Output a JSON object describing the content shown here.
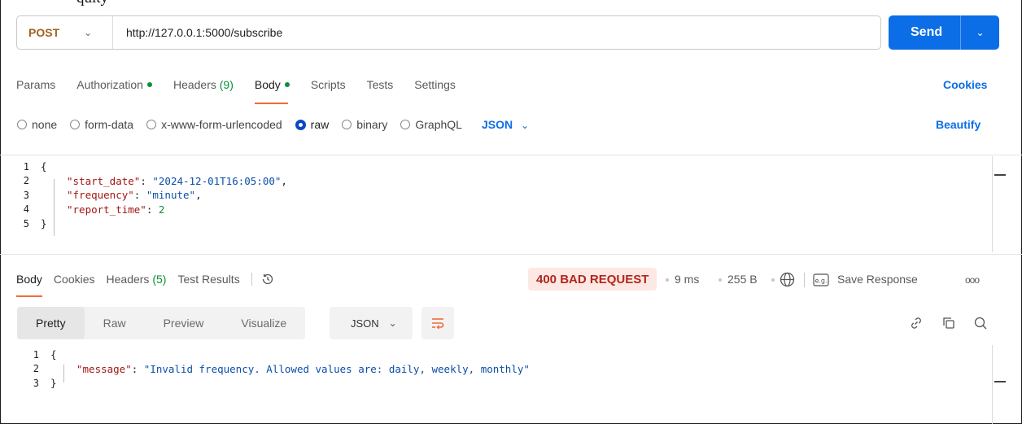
{
  "caption_fragment": "quity",
  "request": {
    "method": "POST",
    "url": "http://127.0.0.1:5000/subscribe",
    "send_label": "Send",
    "tabs": [
      {
        "label": "Params"
      },
      {
        "label": "Authorization"
      },
      {
        "label": "Headers",
        "count": "(9)"
      },
      {
        "label": "Body"
      },
      {
        "label": "Scripts"
      },
      {
        "label": "Tests"
      },
      {
        "label": "Settings"
      }
    ],
    "cookies_label": "Cookies",
    "body_types": [
      "none",
      "form-data",
      "x-www-form-urlencoded",
      "raw",
      "binary",
      "GraphQL"
    ],
    "selected_body_type": "raw",
    "language": "JSON",
    "beautify_label": "Beautify",
    "body_lines": [
      {
        "n": "1",
        "open": "{"
      },
      {
        "n": "2",
        "key": "\"start_date\"",
        "sep": ": ",
        "value": "\"2024-12-01T16:05:00\"",
        "tail": ","
      },
      {
        "n": "3",
        "key": "\"frequency\"",
        "sep": ": ",
        "value": "\"minute\"",
        "tail": ","
      },
      {
        "n": "4",
        "key": "\"report_time\"",
        "sep": ": ",
        "number": "2",
        "tail": ""
      },
      {
        "n": "5",
        "close": "}"
      }
    ]
  },
  "response": {
    "tabs": [
      {
        "label": "Body"
      },
      {
        "label": "Cookies"
      },
      {
        "label": "Headers",
        "count": "(5)"
      },
      {
        "label": "Test Results"
      }
    ],
    "status": "400 BAD REQUEST",
    "time": "9 ms",
    "size": "255 B",
    "save_label": "Save Response",
    "view_modes": [
      "Pretty",
      "Raw",
      "Preview",
      "Visualize"
    ],
    "selected_view": "Pretty",
    "format": "JSON",
    "body_lines": [
      {
        "n": "1",
        "open": "{"
      },
      {
        "n": "2",
        "key": "\"message\"",
        "sep": ": ",
        "value": "\"Invalid frequency. Allowed values are: daily, weekly, monthly\""
      },
      {
        "n": "3",
        "close": "}"
      }
    ]
  },
  "colors": {
    "accent_blue": "#0b6ee6",
    "method_orange": "#a0621f",
    "status_red": "#b3261e",
    "status_bg": "#fde8e4",
    "active_tab_underline": "#f26b3a",
    "green": "#0a8f39"
  }
}
